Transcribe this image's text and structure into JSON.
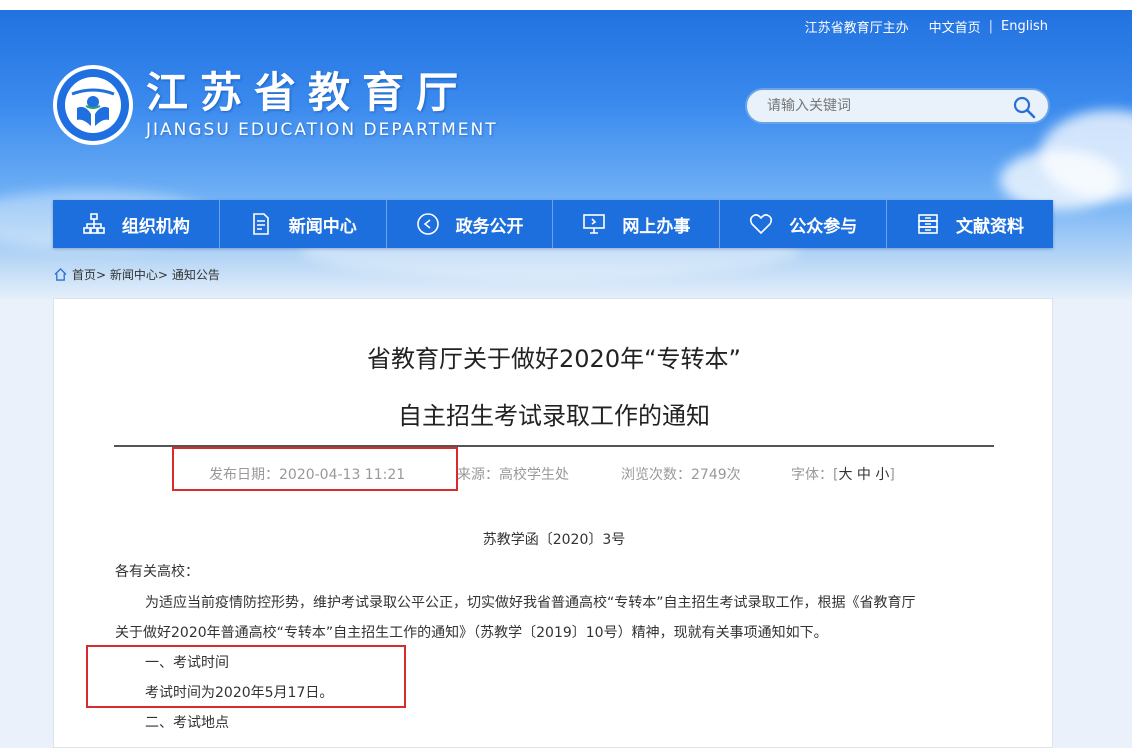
{
  "header": {
    "top_links": {
      "sponsor": "江苏省教育厅主办",
      "home_cn": "中文首页",
      "english": "English"
    },
    "brand_cn": "江苏省教育厅",
    "brand_en": "JIANGSU EDUCATION DEPARTMENT",
    "search_placeholder": "请输入关键词"
  },
  "nav": [
    {
      "label": "组织机构",
      "icon": "org-chart-icon"
    },
    {
      "label": "新闻中心",
      "icon": "document-icon"
    },
    {
      "label": "政务公开",
      "icon": "play-circle-icon"
    },
    {
      "label": "网上办事",
      "icon": "monitor-icon"
    },
    {
      "label": "公众参与",
      "icon": "heart-icon"
    },
    {
      "label": "文献资料",
      "icon": "archive-icon"
    }
  ],
  "breadcrumb": {
    "home": "首页",
    "sep": ">",
    "section": "新闻中心",
    "page": "通知公告"
  },
  "article": {
    "title_line1": "省教育厅关于做好2020年“专转本”",
    "title_line2": "自主招生考试录取工作的通知",
    "meta": {
      "date": "发布日期：2020-04-13 11:21",
      "source": "来源：高校学生处",
      "views": "浏览次数：2749次",
      "font_label": "字体：[",
      "font_large": "大",
      "font_medium": "中",
      "font_small": "小",
      "font_close": "]"
    },
    "doc_number": "苏教学函〔2020〕3号",
    "salutation": "各有关高校：",
    "para1_line1": "为适应当前疫情防控形势，维护考试录取公平公正，切实做好我省普通高校“专转本”自主招生考试录取工作，根据《省教育厅",
    "para1_line2": "关于做好2020年普通高校“专转本”自主招生工作的通知》（苏教学〔2019〕10号）精神，现就有关事项通知如下。",
    "section1_heading": "一、考试时间",
    "section1_text": "考试时间为2020年5月17日。",
    "section2_heading": "二、考试地点"
  },
  "colors": {
    "nav_bg": "#1e6fde",
    "highlight": "#d92b2b",
    "sky_top": "#1f6fe0"
  }
}
